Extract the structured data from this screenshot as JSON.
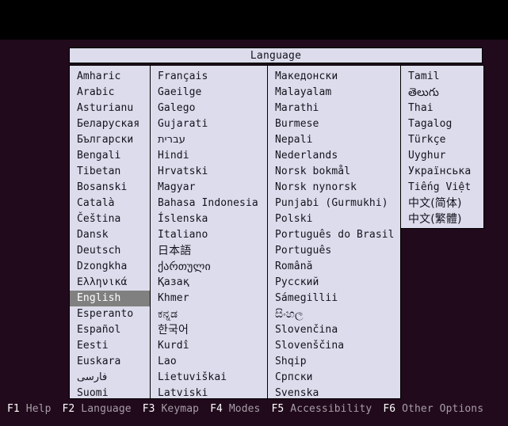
{
  "screen": {
    "background": "#000000",
    "backdrop_color": "#200a1b"
  },
  "dialog": {
    "title": "Language",
    "title_background": "#dcdcec",
    "panel_background": "#dcdcec",
    "text_color": "#14141e",
    "selection_background": "#808080",
    "selection_text_color": "#ffffff",
    "selected_item": "English"
  },
  "columns": [
    {
      "id": "column-1",
      "items": [
        "Amharic",
        "Arabic",
        "Asturianu",
        "Беларуская",
        "Български",
        "Bengali",
        "Tibetan",
        "Bosanski",
        "Català",
        "Čeština",
        "Dansk",
        "Deutsch",
        "Dzongkha",
        "Ελληνικά",
        "English",
        "Esperanto",
        "Español",
        "Eesti",
        "Euskara",
        "فارسی",
        "Suomi"
      ]
    },
    {
      "id": "column-2",
      "items": [
        "Français",
        "Gaeilge",
        "Galego",
        "Gujarati",
        "עברית",
        "Hindi",
        "Hrvatski",
        "Magyar",
        "Bahasa Indonesia",
        "Íslenska",
        "Italiano",
        "日本語",
        "ქართული",
        "Қазақ",
        "Khmer",
        "ಕನ್ನಡ",
        "한국어",
        "Kurdî",
        "Lao",
        "Lietuviškai",
        "Latviski"
      ]
    },
    {
      "id": "column-3",
      "items": [
        "Македонски",
        "Malayalam",
        "Marathi",
        "Burmese",
        "Nepali",
        "Nederlands",
        "Norsk bokmål",
        "Norsk nynorsk",
        "Punjabi (Gurmukhi)",
        "Polski",
        "Português do Brasil",
        "Português",
        "Română",
        "Русский",
        "Sámegillii",
        "සිංහල",
        "Slovenčina",
        "Slovenščina",
        "Shqip",
        "Српски",
        "Svenska"
      ]
    },
    {
      "id": "column-4",
      "items": [
        "Tamil",
        "తెలుగు",
        "Thai",
        "Tagalog",
        "Türkçe",
        "Uyghur",
        "Українська",
        "Tiếng Việt",
        "中文(简体)",
        "中文(繁體)"
      ]
    }
  ],
  "function_bar": {
    "text_color": "#a89ca8",
    "key_color": "#ffffff",
    "items": [
      {
        "key": "F1",
        "label": "Help"
      },
      {
        "key": "F2",
        "label": "Language"
      },
      {
        "key": "F3",
        "label": "Keymap"
      },
      {
        "key": "F4",
        "label": "Modes"
      },
      {
        "key": "F5",
        "label": "Accessibility"
      },
      {
        "key": "F6",
        "label": "Other Options"
      }
    ]
  }
}
